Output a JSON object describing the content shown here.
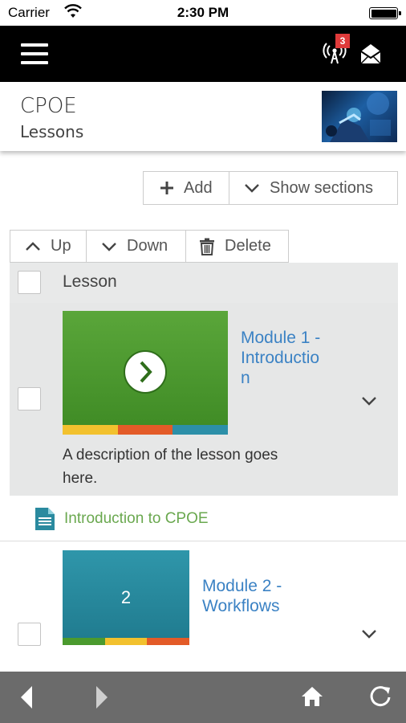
{
  "status_bar": {
    "carrier": "Carrier",
    "time": "2:30 PM"
  },
  "top_nav": {
    "notification_count": "3",
    "icons": [
      "menu-icon",
      "signal-icon",
      "mail-icon"
    ]
  },
  "header": {
    "title": "CPOE",
    "subtitle": "Lessons"
  },
  "toolbar": {
    "add_label": "Add",
    "show_sections_label": "Show sections",
    "up_label": "Up",
    "down_label": "Down",
    "delete_label": "Delete"
  },
  "list": {
    "column_header": "Lesson",
    "lessons": [
      {
        "title": "Module 1 - Introduction",
        "title_lines": [
          "Module 1 -",
          "Introductio",
          "n"
        ],
        "description": "A description of the lesson goes here.",
        "description_lines": [
          "A description of the lesson goes",
          "here."
        ],
        "image_color": "#4b9a2e",
        "stripe_colors": [
          "#f2c12e",
          "#e35b28",
          "#2c8fa8"
        ],
        "subitems": [
          "Introduction to CPOE"
        ]
      },
      {
        "title": "Module 2 - Workflows",
        "title_lines": [
          "Module 2 -",
          "Workflows"
        ],
        "number": "2",
        "image_color": "#2a8a9f",
        "stripe_colors": [
          "#4b9a2e",
          "#f2c12e",
          "#e35b28"
        ]
      }
    ]
  },
  "bottom_bar": {
    "icons": [
      "back-icon",
      "forward-icon",
      "home-icon",
      "refresh-icon"
    ]
  },
  "colors": {
    "link": "#3b82c4",
    "subitem": "#6aa84f",
    "badge": "#e03a3a",
    "nav_bg": "#000000",
    "toolbar_bg": "#6b6b6b"
  }
}
